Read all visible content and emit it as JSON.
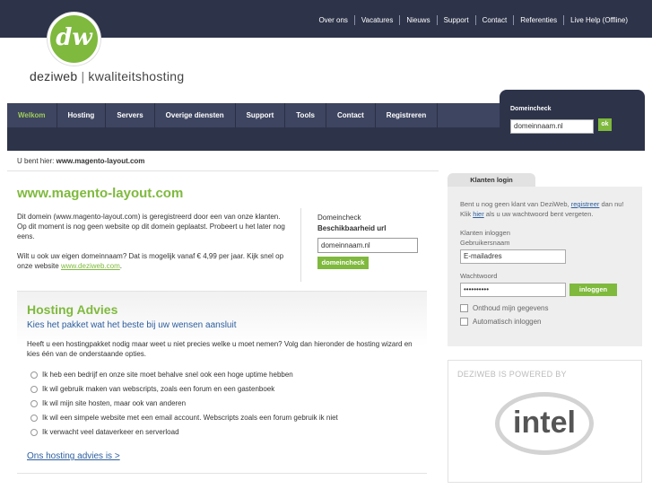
{
  "top_links": [
    "Over ons",
    "Vacatures",
    "Nieuws",
    "Support",
    "Contact",
    "Referenties",
    "Live Help (Offline)"
  ],
  "logo_text": "dw",
  "brand": {
    "name": "deziweb",
    "separator": "|",
    "tagline": "kwaliteitshosting"
  },
  "nav": [
    "Welkom",
    "Hosting",
    "Servers",
    "Overige diensten",
    "Support",
    "Tools",
    "Contact",
    "Registreren"
  ],
  "domaincheck_header": {
    "label": "Domeincheck",
    "input_value": "domeinnaam.nl",
    "button": "ok"
  },
  "breadcrumb": {
    "prefix": "U bent hier:",
    "current": "www.magento-layout.com"
  },
  "domain_title": "www.magento-layout.com",
  "intro": {
    "p1": "Dit domein (www.magento-layout.com) is geregistreerd door een van onze klanten. Op dit moment is nog geen website op dit domein geplaatst. Probeert u het later nog eens.",
    "p2_text": "Wilt u ook uw eigen domeinnaam? Dat is mogelijk vanaf € 4,99 per jaar. Kijk snel op onze website",
    "p2_link": "www.deziweb.com",
    "p2_end": "."
  },
  "domaincheck2": {
    "label": "Domeincheck",
    "sublabel": "Beschikbaarheid url",
    "input_value": "domeinnaam.nl",
    "button": "domeincheck"
  },
  "advies": {
    "title": "Hosting Advies",
    "subtitle": "Kies het pakket wat het beste bij uw wensen aansluit",
    "text": "Heeft u een hostingpakket nodig maar weet u niet precies welke u moet nemen? Volg dan hieronder de hosting wizard en kies één van de onderstaande opties.",
    "options": [
      "Ik heb een bedrijf en onze site moet behalve snel ook een hoge uptime hebben",
      "Ik wil gebruik maken van webscripts, zoals een forum en een gastenboek",
      "Ik wil mijn site hosten, maar ook van anderen",
      "Ik wil een simpele website met een email account. Webscripts zoals een forum gebruik ik niet",
      "Ik verwacht veel dataverkeer en serverload"
    ],
    "link": "Ons hosting advies is >"
  },
  "login": {
    "tab": "Klanten login",
    "text_a": "Bent u nog geen klant van DeziWeb,",
    "link1": "registreer",
    "text_b": "dan nu! Klik",
    "link2": "hier",
    "text_c": "als u uw wachtwoord bent vergeten.",
    "klanten_label": "Klanten inloggen",
    "user_label": "Gebruikersnaam",
    "user_value": "E-mailadres",
    "pass_label": "Wachtwoord",
    "pass_value": "••••••••••",
    "button": "inloggen",
    "remember": "Onthoud mijn gegevens",
    "auto": "Automatisch inloggen"
  },
  "powered": {
    "title": "DEZIWEB IS POWERED BY",
    "logo": "intel"
  }
}
